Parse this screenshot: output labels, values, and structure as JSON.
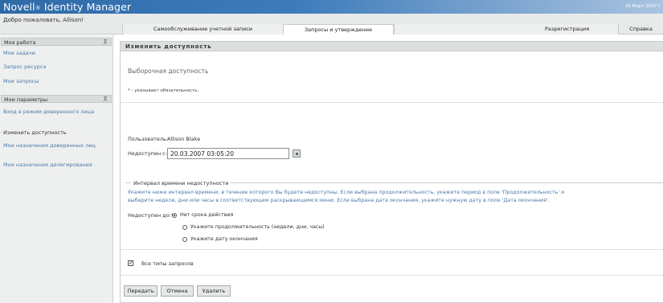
{
  "header": {
    "title": "Novell",
    "title_reg": "®",
    "title_rest": " Identity Manager",
    "date": "26 Март 2007 г"
  },
  "nav": {
    "welcome": "Добро пожаловать, Allison!",
    "tabs": [
      {
        "label": "Самообслуживание учетной записи"
      },
      {
        "label": "Запросы и утверждение"
      }
    ],
    "register": "Разрегистрация",
    "help": "Справка"
  },
  "sidebar": {
    "sections": [
      {
        "title": "Моя работа",
        "items": [
          "Мои задачи",
          "Запрос ресурса",
          "Мои запросы"
        ]
      },
      {
        "title": "Мои параметры",
        "items": [
          "Вход в режим доверенного лица",
          "Изменить доступность",
          "Мои назначения доверенных лиц",
          "Мои назначения делегирования"
        ]
      }
    ]
  },
  "panel": {
    "title": "Изменить доступность",
    "subtitle": "Выборочная доступность",
    "required_note": "* - указывает обязательность.",
    "user_label": "Пользователь:",
    "user_value": "Allison Blake",
    "unavailable_from_label": "Недоступен с:*",
    "unavailable_from_value": "20.03.2007 03:05:20",
    "legend": "Интервал времени недоступности",
    "info_line1": "Укажите ниже интервал времени, в течение которого Вы будете недоступны. Если выбрана продолжительность, укажите период в поле 'Продолжительность' и",
    "info_line2": "выберите недели, дни или часы в соответствующем раскрывающемся меню. Если выбрана дата окончания, укажите нужную дату в поле 'Дата окончания'.",
    "unavailable_to_label": "Недоступен до:*",
    "radio_options": [
      {
        "label": "Нет срока действия",
        "checked": true
      },
      {
        "label": "Укажите продолжительность (недели, дни, часы)",
        "checked": false
      },
      {
        "label": "Укажите дату окончания",
        "checked": false
      }
    ],
    "all_request_types_label": "Все типы запросов",
    "all_request_types_checked": true,
    "buttons": {
      "submit": "Передать",
      "cancel": "Отмена",
      "delete": "Удалить"
    }
  }
}
